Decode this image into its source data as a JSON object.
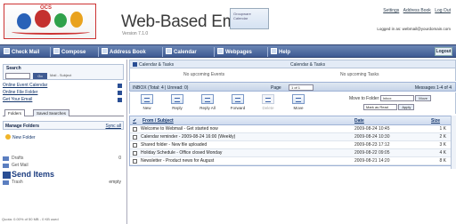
{
  "header": {
    "title": "Web-Based Email",
    "version": "Version 7.1.0",
    "badge": "Groupware Calendar",
    "links": [
      "Settings",
      "Address Book",
      "Log Out"
    ],
    "account_line": "Logged in as: webmail@yourdomain.com"
  },
  "toolbar": {
    "items": [
      "Check Mail",
      "Compose",
      "Address Book",
      "Calendar",
      "Webpages",
      "Help"
    ],
    "logout": "Logout"
  },
  "left": {
    "search_label": "Search",
    "search_go": "Go",
    "search_options": "Mail - Subject",
    "quick_links": [
      "Online Event Calendar",
      "Online File Folder",
      "Get Your Email"
    ],
    "tabs": [
      "Folders",
      "Saved Searches"
    ],
    "folders_title": "Manage Folders",
    "folders_link": "Sync all",
    "new_folder": "New Folder",
    "folders": [
      {
        "name": "Drafts",
        "count": "0",
        "big": false
      },
      {
        "name": "Get Mail",
        "count": "",
        "big": false
      },
      {
        "name": "Send Items",
        "count": "",
        "big": true
      },
      {
        "name": "Trash",
        "count": "empty",
        "big": false
      }
    ],
    "status": "Quota: 0.00% of 50 MB - 0 KB used"
  },
  "main": {
    "panel_left": "Calendar & Tasks",
    "panel_right": "Calendar & Tasks",
    "sub_left": "No upcoming Events",
    "sub_right": "No upcoming Tasks",
    "inbox_label": "INBOX (Total: 4 | Unread: 0)",
    "page_label": "Page",
    "page_value": "1 of 1",
    "page_right": "Messages 1-4 of 4",
    "actions": [
      "New",
      "Reply",
      "Reply All",
      "Forward",
      "Delete",
      "Move"
    ],
    "actions_faded": [
      false,
      false,
      false,
      false,
      true,
      false
    ],
    "move_label": "Move to Folder",
    "move_option": "Inbox",
    "move_btn": "Move",
    "flag_option": "Mark as Read",
    "flag_btn": "Apply",
    "columns": {
      "from": "From / Subject",
      "date": "Date",
      "size": "Size"
    },
    "rows": [
      {
        "from": "Welcome to Webmail - Get started now",
        "date": "2009-08-24 10:45",
        "size": "1 K"
      },
      {
        "from": "Calendar reminder - 2009-08-24 16:00 (Weekly)",
        "date": "2009-08-24 10:30",
        "size": "2 K"
      },
      {
        "from": "Shared folder - New file uploaded",
        "date": "2009-08-23 17:12",
        "size": "3 K"
      },
      {
        "from": "Holiday Schedule - Office closed Monday",
        "date": "2009-08-22 09:05",
        "size": "4 K"
      },
      {
        "from": "Newsletter - Product news for August",
        "date": "2009-08-21 14:20",
        "size": "8 K"
      }
    ]
  }
}
